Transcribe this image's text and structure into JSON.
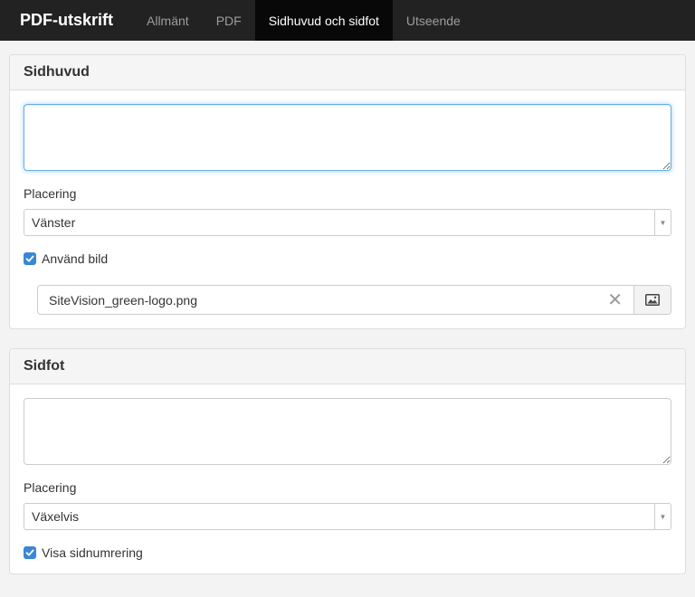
{
  "navbar": {
    "brand": "PDF-utskrift",
    "tabs": [
      {
        "label": "Allmänt"
      },
      {
        "label": "PDF"
      },
      {
        "label": "Sidhuvud och sidfot"
      },
      {
        "label": "Utseende"
      }
    ],
    "active_tab": "Sidhuvud och sidfot"
  },
  "header_panel": {
    "title": "Sidhuvud",
    "text_value": "",
    "placement_label": "Placering",
    "placement_value": "Vänster",
    "use_image_label": "Använd bild",
    "use_image_checked": true,
    "image_file": "SiteVision_green-logo.png",
    "clear_icon": "close-icon",
    "image_icon": "image-icon"
  },
  "footer_panel": {
    "title": "Sidfot",
    "text_value": "",
    "placement_label": "Placering",
    "placement_value": "Växelvis",
    "page_numbers_label": "Visa sidnumrering",
    "page_numbers_checked": true
  },
  "colors": {
    "navbar_bg": "#222222",
    "active_tab_bg": "#080808",
    "checkbox": "#3a87d6",
    "focus_border": "#66afe9"
  }
}
